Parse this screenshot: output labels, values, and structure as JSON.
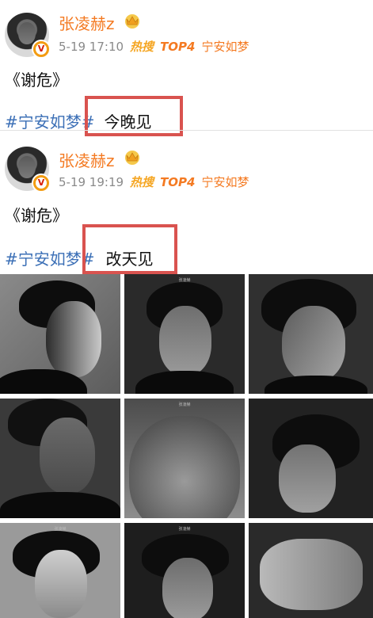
{
  "posts": [
    {
      "username": "张凌赫z",
      "time": "5-19 17:10",
      "hot_label": "热搜",
      "top_label": "TOP4",
      "topic": "宁安如梦",
      "text": "《谢危》",
      "hashtag": "#宁安如梦#",
      "caption": "今晚见"
    },
    {
      "username": "张凌赫z",
      "time": "5-19 19:19",
      "hot_label": "热搜",
      "top_label": "TOP4",
      "topic": "宁安如梦",
      "text": "《谢危》",
      "hashtag": "#宁安如梦#",
      "caption": "改天见"
    }
  ],
  "photo_tag": "张凌赫",
  "colors": {
    "username": "#f47a22",
    "hashtag": "#3b6fb6",
    "highlight_box": "#d9534f",
    "meta": "#8a8a8a"
  },
  "icons": [
    "avatar",
    "verified-v-icon",
    "crown-icon"
  ]
}
